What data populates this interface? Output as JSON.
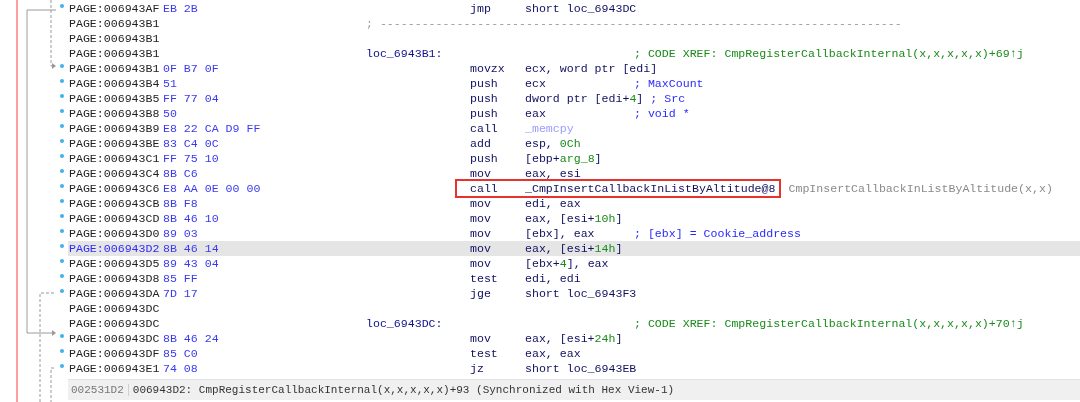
{
  "lines": [
    {
      "kind": "insn",
      "address": "PAGE:006943AF",
      "bytes": "EB 2B",
      "mnemonic": "jmp",
      "operands": [
        {
          "text": "short loc_6943DC",
          "kind": "reg"
        }
      ],
      "selected": false,
      "outlined": false
    },
    {
      "kind": "separator",
      "address": "PAGE:006943B1",
      "text": "; ---------------------------------------------------------------------------",
      "selected": false
    },
    {
      "kind": "blank",
      "address": "PAGE:006943B1",
      "selected": false
    },
    {
      "kind": "label",
      "address": "PAGE:006943B1",
      "label": "loc_6943B1:",
      "comment": {
        "text": "; CODE XREF: CmpRegisterCallbackInternal(x,x,x,x,x)+69↑j",
        "kind": "xref"
      },
      "selected": false
    },
    {
      "kind": "insn",
      "address": "PAGE:006943B1",
      "bytes": "0F B7 0F",
      "mnemonic": "movzx",
      "operands": [
        {
          "text": "ecx, word ptr [edi]",
          "kind": "reg"
        }
      ],
      "selected": false,
      "outlined": false
    },
    {
      "kind": "insn",
      "address": "PAGE:006943B4",
      "bytes": "51",
      "mnemonic": "push",
      "operands": [
        {
          "text": "ecx",
          "kind": "reg"
        }
      ],
      "comment": {
        "text": "; MaxCount",
        "kind": "auto"
      },
      "selected": false,
      "outlined": false
    },
    {
      "kind": "insn",
      "address": "PAGE:006943B5",
      "bytes": "FF 77 04",
      "mnemonic": "push",
      "operands": [
        {
          "text": "dword ptr [edi+",
          "kind": "reg"
        },
        {
          "text": "4",
          "kind": "num"
        },
        {
          "text": "]",
          "kind": "reg"
        }
      ],
      "comment": {
        "text": "; Src",
        "kind": "auto"
      },
      "selected": false,
      "outlined": false
    },
    {
      "kind": "insn",
      "address": "PAGE:006943B8",
      "bytes": "50",
      "mnemonic": "push",
      "operands": [
        {
          "text": "eax",
          "kind": "reg"
        }
      ],
      "comment": {
        "text": "; void *",
        "kind": "auto"
      },
      "selected": false,
      "outlined": false
    },
    {
      "kind": "insn",
      "address": "PAGE:006943B9",
      "bytes": "E8 22 CA D9 FF",
      "mnemonic": "call",
      "operands": [
        {
          "text": "_memcpy",
          "kind": "import"
        }
      ],
      "selected": false,
      "outlined": false
    },
    {
      "kind": "insn",
      "address": "PAGE:006943BE",
      "bytes": "83 C4 0C",
      "mnemonic": "add",
      "operands": [
        {
          "text": "esp, ",
          "kind": "reg"
        },
        {
          "text": "0Ch",
          "kind": "num"
        }
      ],
      "selected": false,
      "outlined": false
    },
    {
      "kind": "insn",
      "address": "PAGE:006943C1",
      "bytes": "FF 75 10",
      "mnemonic": "push",
      "operands": [
        {
          "text": "[ebp+",
          "kind": "reg"
        },
        {
          "text": "arg_8",
          "kind": "num"
        },
        {
          "text": "]",
          "kind": "reg"
        }
      ],
      "selected": false,
      "outlined": false
    },
    {
      "kind": "insn",
      "address": "PAGE:006943C4",
      "bytes": "8B C6",
      "mnemonic": "mov",
      "operands": [
        {
          "text": "eax, esi",
          "kind": "reg"
        }
      ],
      "selected": false,
      "outlined": false
    },
    {
      "kind": "insn",
      "address": "PAGE:006943C6",
      "bytes": "E8 AA 0E 00 00",
      "mnemonic": "call",
      "operands": [
        {
          "text": "_CmpInsertCallbackInListByAltitude@8",
          "kind": "reg"
        }
      ],
      "comment": {
        "text": "CmpInsertCallbackInListByAltitude(x,x)",
        "kind": "hint"
      },
      "selected": false,
      "outlined": true
    },
    {
      "kind": "insn",
      "address": "PAGE:006943CB",
      "bytes": "8B F8",
      "mnemonic": "mov",
      "operands": [
        {
          "text": "edi, eax",
          "kind": "reg"
        }
      ],
      "selected": false,
      "outlined": false
    },
    {
      "kind": "insn",
      "address": "PAGE:006943CD",
      "bytes": "8B 46 10",
      "mnemonic": "mov",
      "operands": [
        {
          "text": "eax, [esi+",
          "kind": "reg"
        },
        {
          "text": "10h",
          "kind": "num"
        },
        {
          "text": "]",
          "kind": "reg"
        }
      ],
      "selected": false,
      "outlined": false
    },
    {
      "kind": "insn",
      "address": "PAGE:006943D0",
      "bytes": "89 03",
      "mnemonic": "mov",
      "operands": [
        {
          "text": "[ebx], eax",
          "kind": "reg"
        }
      ],
      "comment": {
        "text": "; [ebx] = Cookie_address",
        "kind": "auto"
      },
      "selected": false,
      "outlined": false
    },
    {
      "kind": "insn",
      "address": "PAGE:006943D2",
      "bytes": "8B 46 14",
      "mnemonic": "mov",
      "operands": [
        {
          "text": "eax, [esi+",
          "kind": "reg"
        },
        {
          "text": "14h",
          "kind": "num"
        },
        {
          "text": "]",
          "kind": "reg"
        }
      ],
      "selected": true,
      "outlined": false
    },
    {
      "kind": "insn",
      "address": "PAGE:006943D5",
      "bytes": "89 43 04",
      "mnemonic": "mov",
      "operands": [
        {
          "text": "[ebx+",
          "kind": "reg"
        },
        {
          "text": "4",
          "kind": "num"
        },
        {
          "text": "], eax",
          "kind": "reg"
        }
      ],
      "selected": false,
      "outlined": false
    },
    {
      "kind": "insn",
      "address": "PAGE:006943D8",
      "bytes": "85 FF",
      "mnemonic": "test",
      "operands": [
        {
          "text": "edi, edi",
          "kind": "reg"
        }
      ],
      "selected": false,
      "outlined": false
    },
    {
      "kind": "insn",
      "address": "PAGE:006943DA",
      "bytes": "7D 17",
      "mnemonic": "jge",
      "operands": [
        {
          "text": "short loc_6943F3",
          "kind": "reg"
        }
      ],
      "selected": false,
      "outlined": false
    },
    {
      "kind": "blank",
      "address": "PAGE:006943DC",
      "selected": false
    },
    {
      "kind": "label",
      "address": "PAGE:006943DC",
      "label": "loc_6943DC:",
      "comment": {
        "text": "; CODE XREF: CmpRegisterCallbackInternal(x,x,x,x,x)+70↑j",
        "kind": "xref"
      },
      "selected": false
    },
    {
      "kind": "insn",
      "address": "PAGE:006943DC",
      "bytes": "8B 46 24",
      "mnemonic": "mov",
      "operands": [
        {
          "text": "eax, [esi+",
          "kind": "reg"
        },
        {
          "text": "24h",
          "kind": "num"
        },
        {
          "text": "]",
          "kind": "reg"
        }
      ],
      "selected": false,
      "outlined": false
    },
    {
      "kind": "insn",
      "address": "PAGE:006943DF",
      "bytes": "85 C0",
      "mnemonic": "test",
      "operands": [
        {
          "text": "eax, eax",
          "kind": "reg"
        }
      ],
      "selected": false,
      "outlined": false
    },
    {
      "kind": "insn",
      "address": "PAGE:006943E1",
      "bytes": "74 08",
      "mnemonic": "jz",
      "operands": [
        {
          "text": "short loc_6943EB",
          "kind": "reg"
        }
      ],
      "selected": false,
      "outlined": false
    }
  ],
  "status_bar": {
    "offset": "002531D2",
    "location": "006943D2: CmpRegisterCallbackInternal(x,x,x,x,x)+93 (Synchronized with Hex View-1)"
  }
}
